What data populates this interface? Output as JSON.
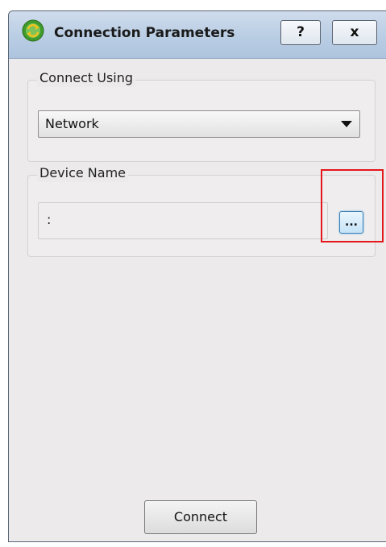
{
  "window": {
    "title": "Connection Parameters",
    "help_label": "?",
    "close_label": "x"
  },
  "connect_using": {
    "label": "Connect Using",
    "selected": "Network"
  },
  "device_name": {
    "label": "Device Name",
    "value": ":",
    "browse_label": "..."
  },
  "footer": {
    "connect_label": "Connect"
  },
  "colors": {
    "highlight": "#e4171b",
    "titlebar": "#b9cde4",
    "icon_green": "#3f9b2a",
    "icon_yellow": "#f2c21b"
  }
}
